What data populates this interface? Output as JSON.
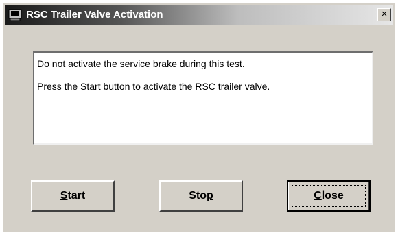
{
  "window": {
    "title": "RSC Trailer Valve Activation",
    "close_glyph": "×",
    "icon": "app-icon"
  },
  "message": {
    "line1": "Do not activate the service brake during this test.",
    "line2": "Press the Start button to activate the RSC trailer valve."
  },
  "buttons": {
    "start": {
      "pre": "",
      "accel": "S",
      "post": "tart"
    },
    "stop": {
      "pre": "Sto",
      "accel": "p",
      "post": ""
    },
    "close": {
      "pre": "",
      "accel": "C",
      "post": "lose"
    }
  }
}
